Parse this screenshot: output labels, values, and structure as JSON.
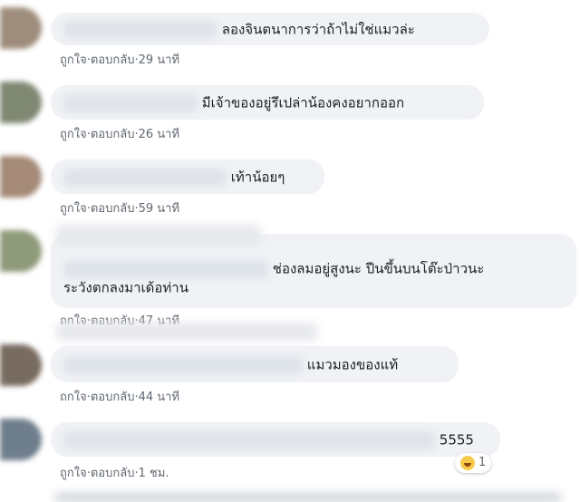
{
  "meta": {
    "like": "ถูกใจ",
    "sep": " · ",
    "reply": "ตอบกลับ"
  },
  "comments": [
    {
      "text": "ลองจินตนาการว่าถ้าไม่ใช่แมวล่ะ",
      "name_tail": "n",
      "time": "29 นาที"
    },
    {
      "text": "มีเจ้าของอยู่รึเปล่าน้องคงอยากออก",
      "name_tail": "n",
      "time": "26 นาที"
    },
    {
      "text": "เท้าน้อยๆ",
      "name_tail": "a",
      "time": "59 นาที"
    },
    {
      "text_line1": "ช่องลมอยู่สูงนะ ปีนขึ้นบนโต๊ะป่าวนะ",
      "text_line2": "ระวังตกลงมาเด้อท่าน",
      "name_tail": "g",
      "time": "47 นาที"
    },
    {
      "text": "แมวมองของแท้",
      "name_tail": "s",
      "time": "44 นาที"
    },
    {
      "text": "5555",
      "time": "1 ชม.",
      "reaction_count": "1",
      "reaction_icon": "laugh-emoji-icon"
    }
  ]
}
